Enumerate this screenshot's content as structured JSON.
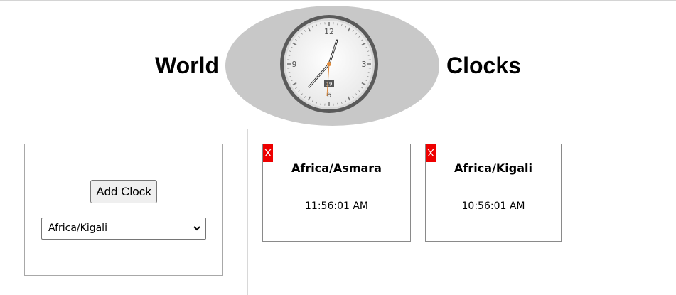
{
  "header": {
    "title_left": "World",
    "title_right": "Clocks",
    "clock_face": {
      "numerals": [
        "12",
        "3",
        "6",
        "9"
      ],
      "date": "19",
      "time_shown": "7:56:31"
    }
  },
  "controls": {
    "add_button_label": "Add Clock",
    "timezone_select": {
      "selected": "Africa/Kigali"
    }
  },
  "clocks": [
    {
      "close_label": "X",
      "zone": "Africa/Asmara",
      "time": "11:56:01 AM"
    },
    {
      "close_label": "X",
      "zone": "Africa/Kigali",
      "time": "10:56:01 AM"
    }
  ],
  "colors": {
    "close_button_bg": "#ee0000",
    "oval_bg": "#c8c8c8"
  }
}
